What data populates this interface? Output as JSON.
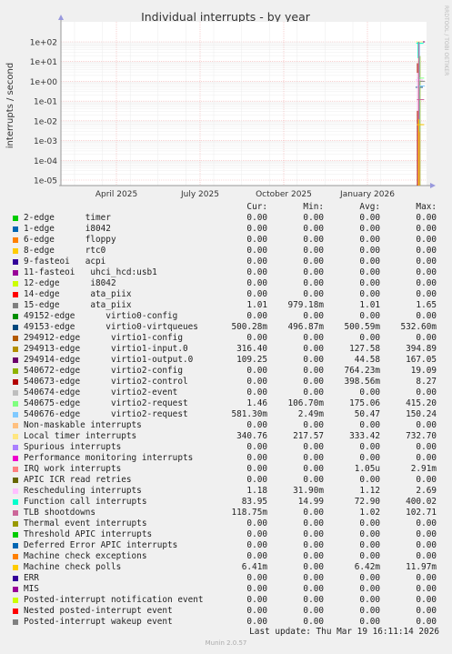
{
  "chart_data": {
    "type": "line",
    "title": "Individual interrupts - by year",
    "ylabel": "interrupts / second",
    "y_scale": "log",
    "ylim": [
      1e-05,
      100
    ],
    "y_ticks": [
      "1e+02",
      "1e+01",
      "1e+00",
      "1e-01",
      "1e-02",
      "1e-03",
      "1e-04",
      "1e-05"
    ],
    "x_ticks": [
      "April 2025",
      "July 2025",
      "October 2025",
      "January 2026"
    ],
    "grid": true,
    "legend_columns": [
      "Cur:",
      "Min:",
      "Avg:",
      "Max:"
    ],
    "series": [
      {
        "name": "2-edge      timer",
        "color": "#00cc00",
        "cur": "0.00",
        "min": "0.00",
        "avg": "0.00",
        "max": "0.00"
      },
      {
        "name": "1-edge      i8042",
        "color": "#0066b3",
        "cur": "0.00",
        "min": "0.00",
        "avg": "0.00",
        "max": "0.00"
      },
      {
        "name": "6-edge      floppy",
        "color": "#ff8000",
        "cur": "0.00",
        "min": "0.00",
        "avg": "0.00",
        "max": "0.00"
      },
      {
        "name": "8-edge      rtc0",
        "color": "#ffcc00",
        "cur": "0.00",
        "min": "0.00",
        "avg": "0.00",
        "max": "0.00"
      },
      {
        "name": "9-fasteoi   acpi",
        "color": "#330099",
        "cur": "0.00",
        "min": "0.00",
        "avg": "0.00",
        "max": "0.00"
      },
      {
        "name": "11-fasteoi   uhci_hcd:usb1",
        "color": "#990099",
        "cur": "0.00",
        "min": "0.00",
        "avg": "0.00",
        "max": "0.00"
      },
      {
        "name": "12-edge      i8042",
        "color": "#ccff00",
        "cur": "0.00",
        "min": "0.00",
        "avg": "0.00",
        "max": "0.00"
      },
      {
        "name": "14-edge      ata_piix",
        "color": "#ff0000",
        "cur": "0.00",
        "min": "0.00",
        "avg": "0.00",
        "max": "0.00"
      },
      {
        "name": "15-edge      ata_piix",
        "color": "#808080",
        "cur": "1.01",
        "min": "979.18m",
        "avg": "1.01",
        "max": "1.65"
      },
      {
        "name": "49152-edge      virtio0-config",
        "color": "#008f00",
        "cur": "0.00",
        "min": "0.00",
        "avg": "0.00",
        "max": "0.00"
      },
      {
        "name": "49153-edge      virtio0-virtqueues",
        "color": "#00487d",
        "cur": "500.28m",
        "min": "496.87m",
        "avg": "500.59m",
        "max": "532.60m"
      },
      {
        "name": "294912-edge      virtio1-config",
        "color": "#b35a00",
        "cur": "0.00",
        "min": "0.00",
        "avg": "0.00",
        "max": "0.00"
      },
      {
        "name": "294913-edge      virtio1-input.0",
        "color": "#b38f00",
        "cur": "316.40",
        "min": "0.00",
        "avg": "127.58",
        "max": "394.89"
      },
      {
        "name": "294914-edge      virtio1-output.0",
        "color": "#6b006b",
        "cur": "109.25",
        "min": "0.00",
        "avg": "44.58",
        "max": "167.05"
      },
      {
        "name": "540672-edge      virtio2-config",
        "color": "#8fb300",
        "cur": "0.00",
        "min": "0.00",
        "avg": "764.23m",
        "max": "19.09"
      },
      {
        "name": "540673-edge      virtio2-control",
        "color": "#b30000",
        "cur": "0.00",
        "min": "0.00",
        "avg": "398.56m",
        "max": "8.27"
      },
      {
        "name": "540674-edge      virtio2-event",
        "color": "#bebebe",
        "cur": "0.00",
        "min": "0.00",
        "avg": "0.00",
        "max": "0.00"
      },
      {
        "name": "540675-edge      virtio2-request",
        "color": "#80ff80",
        "cur": "1.46",
        "min": "106.70m",
        "avg": "175.06",
        "max": "415.20"
      },
      {
        "name": "540676-edge      virtio2-request",
        "color": "#80c9ff",
        "cur": "581.30m",
        "min": "2.49m",
        "avg": "50.47",
        "max": "150.24"
      },
      {
        "name": "Non-maskable interrupts",
        "color": "#ffc080",
        "cur": "0.00",
        "min": "0.00",
        "avg": "0.00",
        "max": "0.00"
      },
      {
        "name": "Local timer interrupts",
        "color": "#ffe680",
        "cur": "340.76",
        "min": "217.57",
        "avg": "333.42",
        "max": "732.70"
      },
      {
        "name": "Spurious interrupts",
        "color": "#aa80ff",
        "cur": "0.00",
        "min": "0.00",
        "avg": "0.00",
        "max": "0.00"
      },
      {
        "name": "Performance monitoring interrupts",
        "color": "#ee00cc",
        "cur": "0.00",
        "min": "0.00",
        "avg": "0.00",
        "max": "0.00"
      },
      {
        "name": "IRQ work interrupts",
        "color": "#ff8080",
        "cur": "0.00",
        "min": "0.00",
        "avg": "1.05u",
        "max": "2.91m"
      },
      {
        "name": "APIC ICR read retries",
        "color": "#666600",
        "cur": "0.00",
        "min": "0.00",
        "avg": "0.00",
        "max": "0.00"
      },
      {
        "name": "Rescheduling interrupts",
        "color": "#ffbfff",
        "cur": "1.18",
        "min": "31.90m",
        "avg": "1.12",
        "max": "2.69"
      },
      {
        "name": "Function call interrupts",
        "color": "#00ffcc",
        "cur": "83.95",
        "min": "14.99",
        "avg": "72.90",
        "max": "400.02"
      },
      {
        "name": "TLB shootdowns",
        "color": "#cc6699",
        "cur": "118.75m",
        "min": "0.00",
        "avg": "1.02",
        "max": "102.71"
      },
      {
        "name": "Thermal event interrupts",
        "color": "#999900",
        "cur": "0.00",
        "min": "0.00",
        "avg": "0.00",
        "max": "0.00"
      },
      {
        "name": "Threshold APIC interrupts",
        "color": "#00cc00",
        "cur": "0.00",
        "min": "0.00",
        "avg": "0.00",
        "max": "0.00"
      },
      {
        "name": "Deferred Error APIC interrupts",
        "color": "#0066b3",
        "cur": "0.00",
        "min": "0.00",
        "avg": "0.00",
        "max": "0.00"
      },
      {
        "name": "Machine check exceptions",
        "color": "#ff8000",
        "cur": "0.00",
        "min": "0.00",
        "avg": "0.00",
        "max": "0.00"
      },
      {
        "name": "Machine check polls",
        "color": "#ffcc00",
        "cur": "6.41m",
        "min": "0.00",
        "avg": "6.42m",
        "max": "11.97m"
      },
      {
        "name": "ERR",
        "color": "#330099",
        "cur": "0.00",
        "min": "0.00",
        "avg": "0.00",
        "max": "0.00"
      },
      {
        "name": "MIS",
        "color": "#990099",
        "cur": "0.00",
        "min": "0.00",
        "avg": "0.00",
        "max": "0.00"
      },
      {
        "name": "Posted-interrupt notification event",
        "color": "#ccff00",
        "cur": "0.00",
        "min": "0.00",
        "avg": "0.00",
        "max": "0.00"
      },
      {
        "name": "Nested posted-interrupt event",
        "color": "#ff0000",
        "cur": "0.00",
        "min": "0.00",
        "avg": "0.00",
        "max": "0.00"
      },
      {
        "name": "Posted-interrupt wakeup event",
        "color": "#808080",
        "cur": "0.00",
        "min": "0.00",
        "avg": "0.00",
        "max": "0.00"
      }
    ]
  },
  "footer": {
    "last_update": "Last update: Thu Mar 19 16:11:14 2026",
    "munin_version": "Munin 2.0.57",
    "side_text": "RRDTOOL / TOBI OETIKER"
  }
}
